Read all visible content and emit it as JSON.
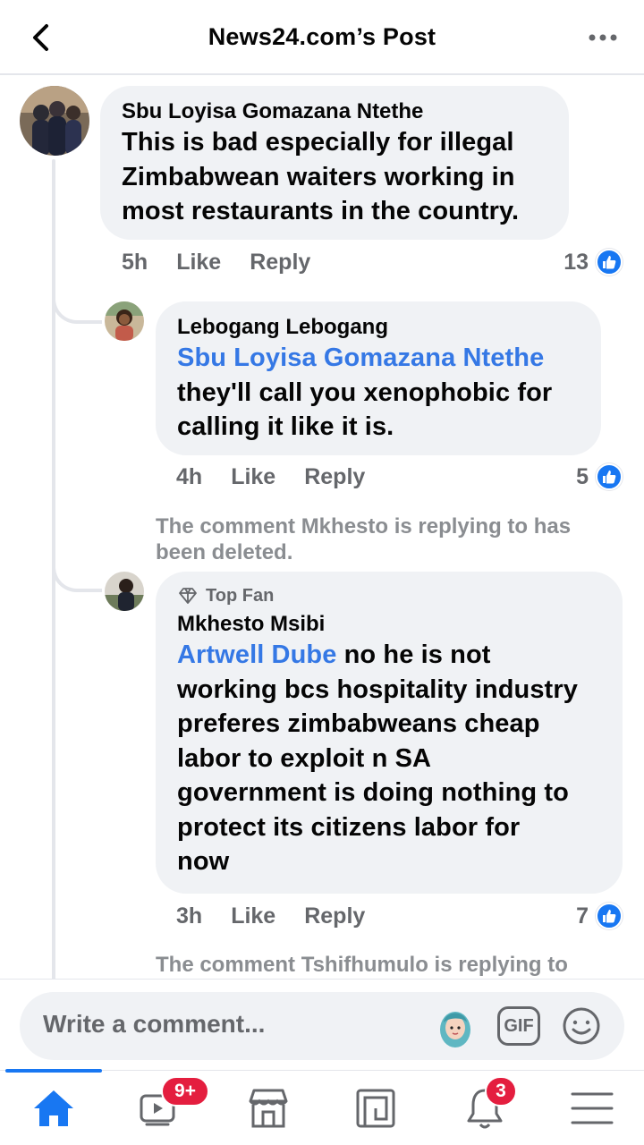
{
  "header": {
    "title": "News24.com’s Post"
  },
  "comments": [
    {
      "author": "Sbu Loyisa Gomazana Ntethe",
      "lines": [
        "This is bad especially for illegal",
        "Zimbabwean waiters working in",
        "most restaurants in the country."
      ],
      "time": "5h",
      "like_label": "Like",
      "reply_label": "Reply",
      "likes": "13"
    },
    {
      "author": "Lebogang Lebogang",
      "mention": "Sbu Loyisa Gomazana Ntethe",
      "lines": [
        "they'll  call you xenophobic for",
        "calling it like it is."
      ],
      "time": "4h",
      "like_label": "Like",
      "reply_label": "Reply",
      "likes": "5"
    },
    {
      "deleted_notice": [
        "The comment Mkhesto is replying to has",
        "been deleted."
      ],
      "badge": "Top Fan",
      "author": "Mkhesto Msibi",
      "mention": "Artwell Dube",
      "first_line_rest": " no he is not",
      "lines": [
        "working bcs hospitality industry",
        "preferes zimbabweans cheap",
        "labor to exploit n SA",
        "government is doing nothing to",
        "protect its citizens labor for",
        "now"
      ],
      "time": "3h",
      "like_label": "Like",
      "reply_label": "Reply",
      "likes": "7"
    }
  ],
  "partial_notice": "The comment Tshifhumulo is replying to",
  "composer": {
    "placeholder": "Write a comment...",
    "gif_label": "GIF"
  },
  "nav": {
    "video_badge": "9+",
    "notifications_badge": "3"
  },
  "colors": {
    "accent": "#1877f2",
    "mention": "#3578e5",
    "bubble": "#f0f2f5",
    "badge": "#e41e3f"
  }
}
